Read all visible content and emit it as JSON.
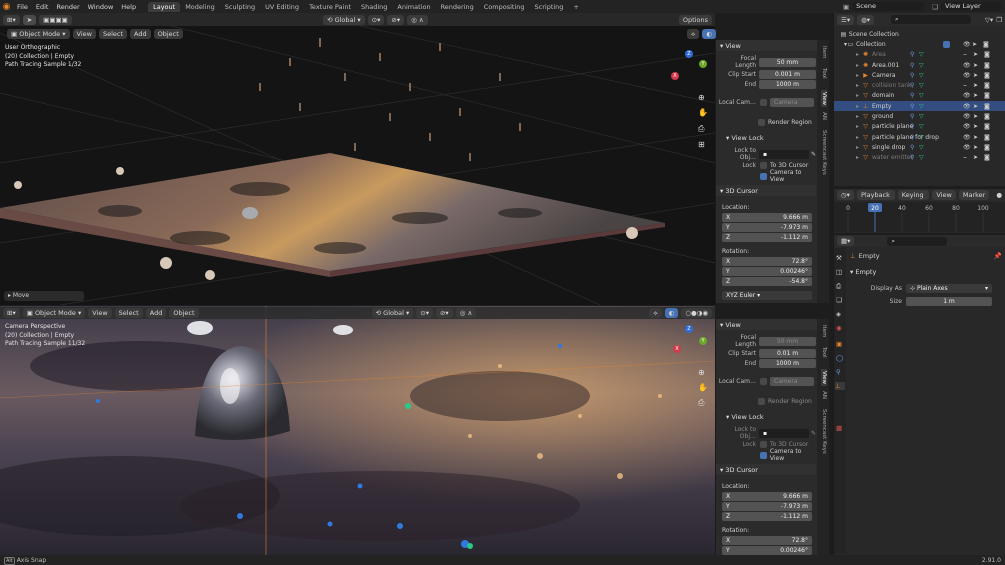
{
  "topbar": {
    "menus": [
      "File",
      "Edit",
      "Render",
      "Window",
      "Help"
    ],
    "workspaces": [
      "Layout",
      "Modeling",
      "Sculpting",
      "UV Editing",
      "Texture Paint",
      "Shading",
      "Animation",
      "Rendering",
      "Compositing",
      "Scripting"
    ],
    "add_tab": "+",
    "scene": "Scene",
    "view_layer": "View Layer"
  },
  "viewport_top": {
    "mode": "Object Mode",
    "menus": [
      "View",
      "Select",
      "Add",
      "Object"
    ],
    "transform": "Global",
    "options": "Options",
    "overlay": [
      "User Orthographic",
      "(20) Collection | Empty",
      "Path Tracing Sample 1/32"
    ],
    "operator": "Move"
  },
  "viewport_bottom": {
    "mode": "Object Mode",
    "menus": [
      "View",
      "Select",
      "Add",
      "Object"
    ],
    "transform": "Global",
    "overlay": [
      "Camera Perspective",
      "(20) Collection | Empty",
      "Path Tracing Sample 11/32"
    ]
  },
  "npanel_top": {
    "view_title": "View",
    "focal_length_label": "Focal Length",
    "focal_length": "50 mm",
    "clip_start_label": "Clip Start",
    "clip_start": "0.001 m",
    "end_label": "End",
    "end": "1000 m",
    "local_camera_label": "Local Cam…",
    "local_camera": "Camera",
    "render_region": "Render Region",
    "view_lock_title": "View Lock",
    "lock_to_obj_label": "Lock to Obj…",
    "lock_label": "Lock",
    "to_3d_cursor": "To 3D Cursor",
    "camera_to_view": "Camera to View",
    "cursor_title": "3D Cursor",
    "location_label": "Location:",
    "loc_x_label": "X",
    "loc_x": "9.666 m",
    "loc_y_label": "Y",
    "loc_y": "-7.973 m",
    "loc_z_label": "Z",
    "loc_z": "-1.112 m",
    "rotation_label": "Rotation:",
    "rot_x_label": "X",
    "rot_x": "72.8°",
    "rot_y_label": "Y",
    "rot_y": "0.00246°",
    "rot_z_label": "Z",
    "rot_z": "-54.8°",
    "rot_mode": "XYZ Euler",
    "tabs": [
      "Item",
      "Tool",
      "View",
      "AN",
      "Screencast Keys"
    ]
  },
  "npanel_bottom": {
    "view_title": "View",
    "focal_length_label": "Focal Length",
    "focal_length": "50 mm",
    "clip_start_label": "Clip Start",
    "clip_start": "0.01 m",
    "end_label": "End",
    "end": "1000 m",
    "local_camera_label": "Local Cam…",
    "local_camera": "Camera",
    "render_region": "Render Region",
    "view_lock_title": "View Lock",
    "lock_to_obj_label": "Lock to Obj…",
    "lock_label": "Lock",
    "to_3d_cursor": "To 3D Cursor",
    "camera_to_view": "Camera to View",
    "cursor_title": "3D Cursor",
    "location_label": "Location:",
    "loc_x_label": "X",
    "loc_x": "9.666 m",
    "loc_y_label": "Y",
    "loc_y": "-7.973 m",
    "loc_z_label": "Z",
    "loc_z": "-1.112 m",
    "rotation_label": "Rotation:",
    "rot_x_label": "X",
    "rot_x": "72.8°",
    "rot_y_label": "Y",
    "rot_y": "0.00246°",
    "tabs": [
      "Item",
      "Tool",
      "View",
      "AN",
      "Screencast Keys"
    ]
  },
  "outliner": {
    "scene_collection": "Scene Collection",
    "collection": "Collection",
    "items": [
      {
        "name": "Area",
        "dim": true,
        "icon": "light-icon"
      },
      {
        "name": "Area.001",
        "dim": false,
        "icon": "light-icon"
      },
      {
        "name": "Camera",
        "dim": false,
        "icon": "camera-icon"
      },
      {
        "name": "collision tank",
        "dim": true,
        "icon": "mesh-icon"
      },
      {
        "name": "domain",
        "dim": false,
        "icon": "mesh-icon"
      },
      {
        "name": "Empty",
        "dim": false,
        "icon": "empty-icon",
        "selected": true
      },
      {
        "name": "ground",
        "dim": false,
        "icon": "mesh-icon"
      },
      {
        "name": "particle plane",
        "dim": false,
        "icon": "mesh-icon"
      },
      {
        "name": "particle plane for drop",
        "dim": false,
        "icon": "mesh-icon"
      },
      {
        "name": "single drop",
        "dim": false,
        "icon": "mesh-icon"
      },
      {
        "name": "water emitter",
        "dim": true,
        "icon": "mesh-icon"
      }
    ]
  },
  "timeline": {
    "menus": [
      "Playback",
      "Keying",
      "View",
      "Marker"
    ],
    "ticks": [
      "0",
      "20",
      "40",
      "60",
      "80",
      "100"
    ],
    "current_frame": "20",
    "current_frame_value": 20
  },
  "properties": {
    "object_name": "Empty",
    "panel_title": "Empty",
    "display_as_label": "Display As",
    "display_as": "Plain Axes",
    "size_label": "Size",
    "size": "1 m"
  },
  "statusbar": {
    "left": "Axis Snap",
    "right": "2.91.0"
  },
  "colors": {
    "accent": "#4772b3",
    "selected_row": "#334d80",
    "active_frame": "#4772b3",
    "orange": "#e8862b"
  }
}
